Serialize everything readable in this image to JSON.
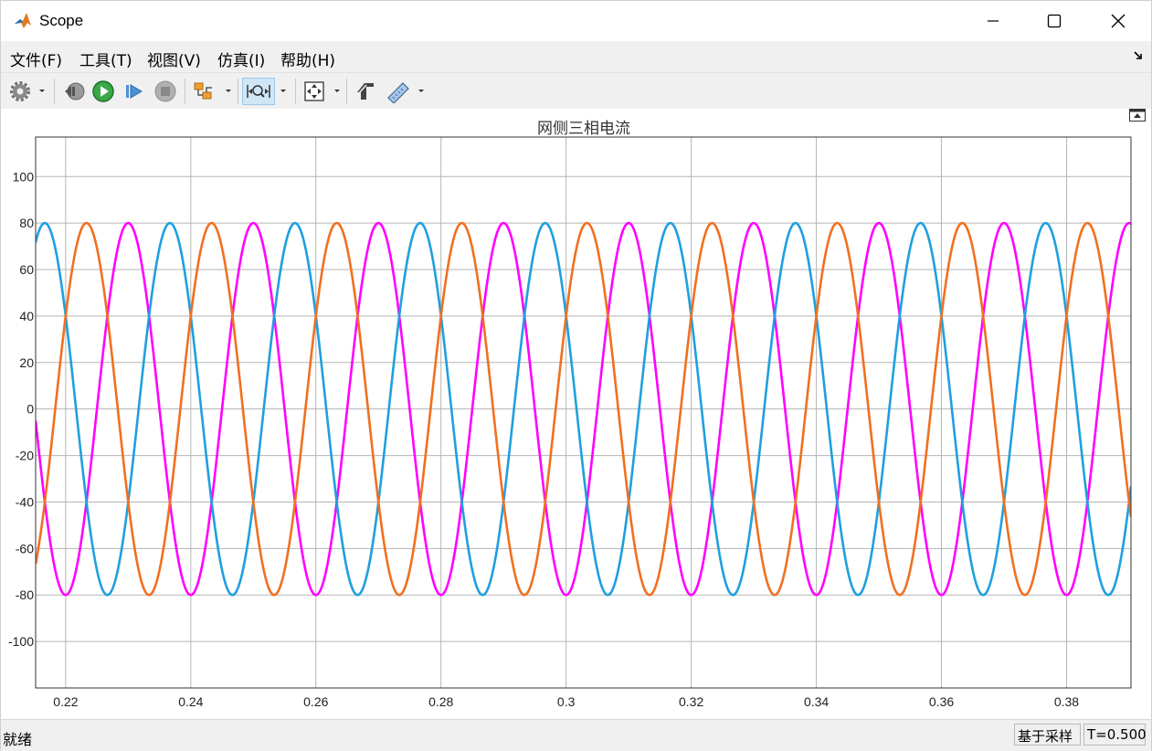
{
  "window": {
    "title": "Scope"
  },
  "menu": [
    {
      "label": "文件(F)"
    },
    {
      "label": "工具(T)"
    },
    {
      "label": "视图(V)"
    },
    {
      "label": "仿真(I)"
    },
    {
      "label": "帮助(H)"
    }
  ],
  "toolbar": {
    "icons": [
      "settings-icon",
      "step-back-icon",
      "run-icon",
      "step-forward-icon",
      "stop-icon",
      "signal-trigger-icon",
      "zoom-x-icon",
      "fit-view-icon",
      "style-icon",
      "measure-icon"
    ],
    "zoom_x_active": true
  },
  "status": {
    "left": "就绪",
    "mode": "基于采样",
    "time": "T=0.500"
  },
  "colors": {
    "series_a": "#ff00ff",
    "series_b": "#1f9fe0",
    "series_c": "#f07020",
    "grid": "#b5b5b5",
    "axes": "#333333"
  },
  "chart_data": {
    "type": "line",
    "title": "网侧三相电流",
    "xlabel": "",
    "ylabel": "",
    "xlim": [
      0.2152,
      0.3903
    ],
    "ylim": [
      -120,
      117
    ],
    "xticks": [
      0.22,
      0.24,
      0.26,
      0.28,
      0.3,
      0.32,
      0.34,
      0.36,
      0.38
    ],
    "xtick_labels": [
      "0.22",
      "0.24",
      "0.26",
      "0.28",
      "0.3",
      "0.32",
      "0.34",
      "0.36",
      "0.38"
    ],
    "yticks": [
      100,
      80,
      60,
      40,
      20,
      0,
      -20,
      -40,
      -60,
      -80,
      -100
    ],
    "ytick_labels": [
      "100",
      "80",
      "60",
      "40",
      "20",
      "0",
      "-20",
      "-40",
      "-60",
      "-80",
      "-100"
    ],
    "grid": true,
    "amplitude": 80,
    "frequency_hz": 50,
    "series": [
      {
        "color": "#ff00ff",
        "phase_deg": -90
      },
      {
        "color": "#1f9fe0",
        "phase_deg": 150
      },
      {
        "color": "#f07020",
        "phase_deg": 30
      }
    ]
  }
}
